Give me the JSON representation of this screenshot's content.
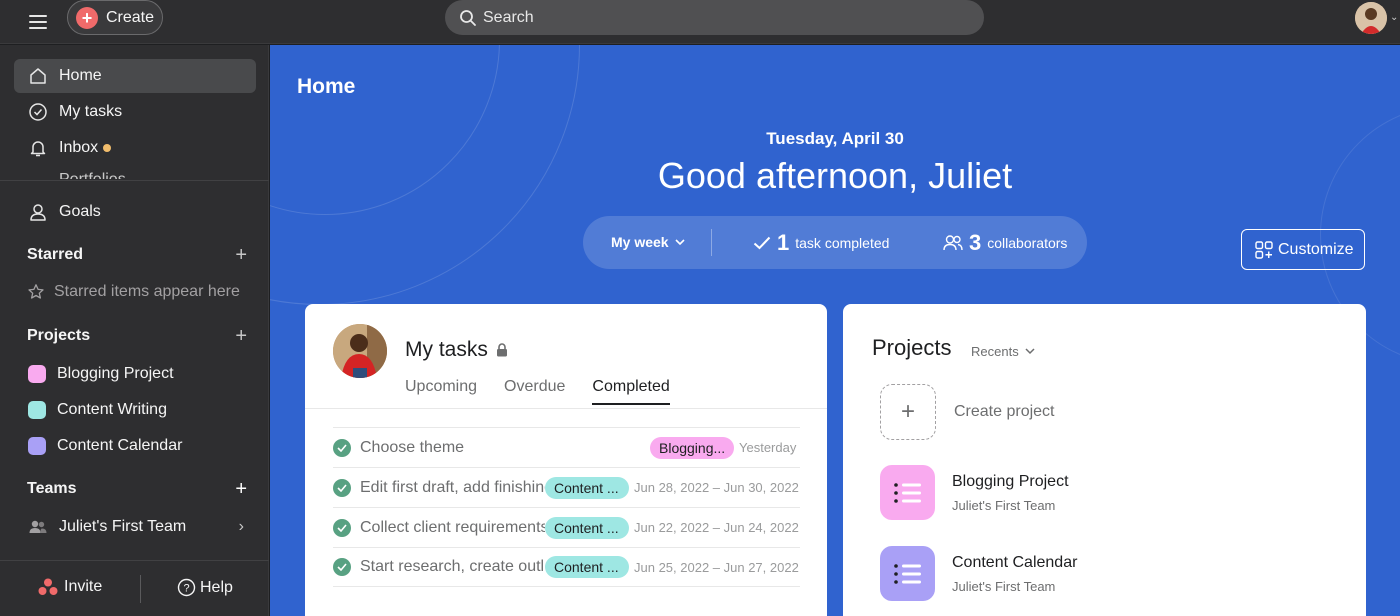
{
  "topbar": {
    "create_label": "Create",
    "search_placeholder": "Search"
  },
  "sidebar": {
    "nav": [
      {
        "label": "Home",
        "icon": "home-icon",
        "active": true
      },
      {
        "label": "My tasks",
        "icon": "check-circle-icon"
      },
      {
        "label": "Inbox",
        "icon": "bell-icon",
        "has_dot": true
      },
      {
        "label": "Portfolios",
        "icon": "folder-icon"
      },
      {
        "label": "Goals",
        "icon": "person-icon"
      }
    ],
    "starred": {
      "title": "Starred",
      "hint": "Starred items appear here"
    },
    "projects": {
      "title": "Projects",
      "items": [
        {
          "label": "Blogging Project",
          "color": "#f9aaef"
        },
        {
          "label": "Content Writing",
          "color": "#9ee7e3"
        },
        {
          "label": "Content Calendar",
          "color": "#cd95ea"
        }
      ]
    },
    "teams": {
      "title": "Teams",
      "items": [
        {
          "label": "Juliet's First Team"
        }
      ]
    },
    "bottom": {
      "invite_label": "Invite",
      "help_label": "Help"
    }
  },
  "main": {
    "title": "Home",
    "date": "Tuesday, April 30",
    "greeting": "Good afternoon, Juliet",
    "stats": {
      "period": "My week",
      "tasks_count": "1",
      "tasks_label": "task completed",
      "collab_count": "3",
      "collab_label": "collaborators"
    },
    "customize_label": "Customize"
  },
  "my_tasks": {
    "title": "My tasks",
    "tabs": [
      "Upcoming",
      "Overdue",
      "Completed"
    ],
    "selected_tab": "Completed",
    "tasks": [
      {
        "name": "Choose theme",
        "tag": "Blogging...",
        "tag_color": "#f9aaef",
        "due": "Yesterday"
      },
      {
        "name": "Edit first draft, add finishing",
        "tag": "Content ...",
        "tag_color": "#9ee7e3",
        "due": "Jun 28, 2022 – Jun 30, 2022"
      },
      {
        "name": "Collect client requirements",
        "tag": "Content ...",
        "tag_color": "#9ee7e3",
        "due": "Jun 22, 2022 – Jun 24, 2022"
      },
      {
        "name": "Start research, create outline",
        "tag": "Content ...",
        "tag_color": "#9ee7e3",
        "due": "Jun 25, 2022 – Jun 27, 2022"
      }
    ]
  },
  "projects_card": {
    "title": "Projects",
    "filter": "Recents",
    "create_label": "Create project",
    "items": [
      {
        "name": "Blogging Project",
        "team": "Juliet's First Team",
        "color": "#f9aaef"
      },
      {
        "name": "Content Calendar",
        "team": "Juliet's First Team",
        "color": "#a9a0f6"
      }
    ]
  },
  "colors": {
    "main_bg": "#3063cf",
    "sidebar_bg": "#2e2e30",
    "accent_create": "#f06a6a",
    "check_green": "#58a182"
  }
}
